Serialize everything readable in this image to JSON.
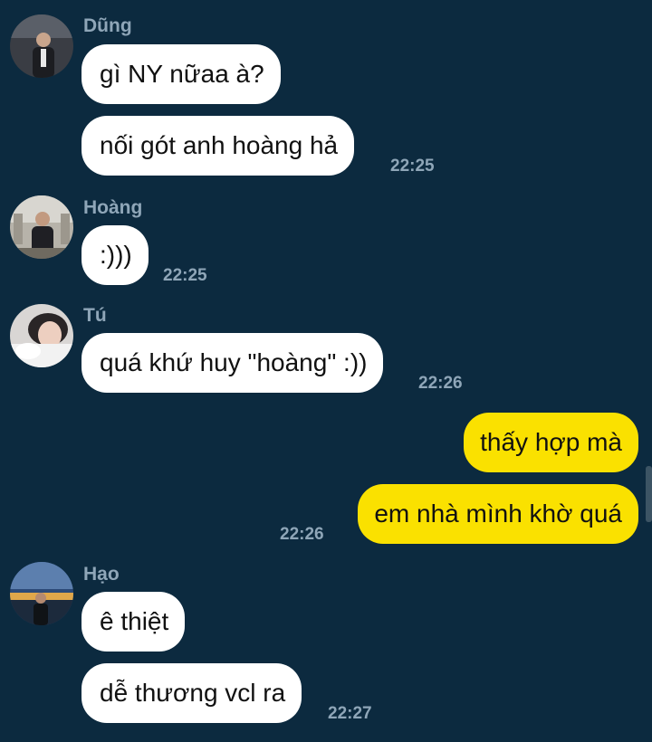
{
  "messages": [
    {
      "sender": "Dũng",
      "text": "gì NY nữaa à?"
    },
    {
      "text": "nối gót anh hoàng hả",
      "time": "22:25"
    },
    {
      "sender": "Hoàng",
      "text": ":)))",
      "time": "22:25"
    },
    {
      "sender": "Tú",
      "text": "quá khứ huy \"hoàng\" :))",
      "time": "22:26"
    },
    {
      "text": "thấy hợp mà"
    },
    {
      "text": "em nhà mình khờ quá",
      "time": "22:26"
    },
    {
      "sender": "Hạo",
      "text": "ê thiệt"
    },
    {
      "text": "dễ thương vcl ra",
      "time": "22:27"
    }
  ],
  "colors": {
    "background": "#0c2a3f",
    "incoming_bubble": "#ffffff",
    "outgoing_bubble": "#fae100",
    "meta_text": "#8fa6b8"
  }
}
